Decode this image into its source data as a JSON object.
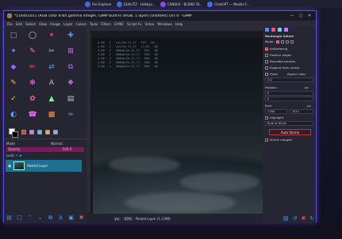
{
  "taskbar": {
    "items": [
      {
        "label": "File Explorer",
        "icon": "folder-icon"
      },
      {
        "label": "DUALITZ - Hobbys...",
        "icon": "browser-icon"
      },
      {
        "label": "CANBUS - BLEND 50...",
        "icon": "browser-icon"
      },
      {
        "label": "ChatGPT — Mozilla F...",
        "icon": "browser-icon"
      }
    ]
  },
  "window": {
    "title": "[Untitled]-1.0 (RGB color 8-bit gamma integer, GIMP built-in sRGB, 1 layer) 1164x1011 – GIMP",
    "title_short": "*1164x1011 (RGB color 8-bit gamma integer, GIMP built-in sRGB, 1 layer) [Untitled] 147.0 - GIMP",
    "menus": [
      "File",
      "Edit",
      "Select",
      "View",
      "Image",
      "Layer",
      "Colors",
      "Tools",
      "Filters",
      "G'MIC",
      "Script-Fu",
      "Video",
      "Windows",
      "Help"
    ]
  },
  "layers": {
    "mode_label": "Mode",
    "mode_value": "Normal",
    "opacity_label": "Opacity",
    "opacity_value": "100.0",
    "lock_label": "Lock:",
    "layer_name": "Pasted Layer"
  },
  "terminal": {
    "rows": [
      [
        "4.00",
        "2",
        "Lat=2e-11.17",
        "FAT",
        "80"
      ],
      [
        "4.00",
        "2",
        "Lat=2e-11.17",
        "+1.81",
        "80"
      ],
      [
        "4.00",
        "2",
        "400mb=2e-11.17",
        "EML",
        "80"
      ],
      [
        "4.00",
        "2",
        "400mb=2e-11.17",
        "ENG",
        "80"
      ],
      [
        "4.00",
        "2",
        "400mb=2e-11.17",
        "ENG",
        "80"
      ],
      [
        "4.00",
        "2",
        "400mb=2e-11.17",
        "ENG",
        "80"
      ],
      [
        "4.00",
        "2",
        "400mb=2e-11.17",
        "ENG",
        "80"
      ]
    ]
  },
  "status": {
    "unit": "px",
    "zoom": "50%",
    "layer_info": "Pasted Layer (1.2 MB)"
  },
  "tool_options": {
    "title": "Rectangle Select",
    "mode_label": "Mode:",
    "antialiasing": "Antialiasing",
    "feather_edges": "Feather edges",
    "rounded_corners": "Rounded corners",
    "expand_from_center": "Expand from center",
    "fixed": "Fixed",
    "aspect_ratio": "Aspect ratio",
    "ratio_value": "2:2",
    "position_label": "Position:",
    "position_unit": "px",
    "position_x": "0",
    "position_y": "0",
    "size_label": "Size:",
    "size_unit": "px",
    "size_w": "1164",
    "size_h": "1011",
    "highlight": "Highlight",
    "guides": "Rule of thirds",
    "auto_shrink": "Auto Shrink",
    "shrink_merged": "Shrink merged"
  },
  "colors": {
    "accent": "#5a4fd8",
    "layer_selected": "#1f6f8f",
    "danger": "#ff4050",
    "icon_blue": "#4f9aff"
  }
}
